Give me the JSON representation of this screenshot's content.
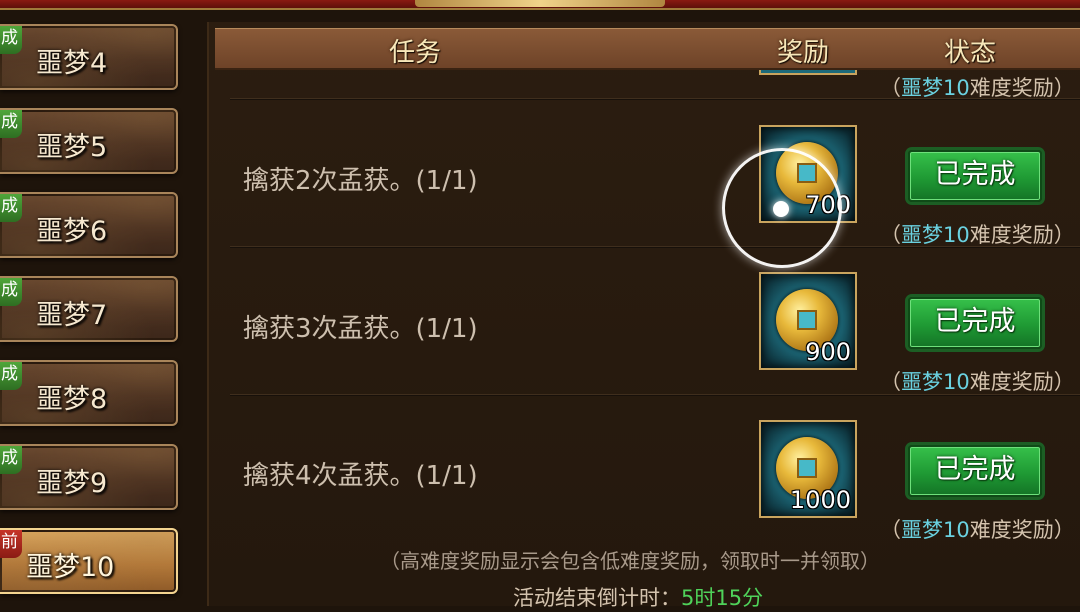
{
  "sidebar": {
    "levels": [
      {
        "tag": "成",
        "label": "噩梦4"
      },
      {
        "tag": "成",
        "label": "噩梦5"
      },
      {
        "tag": "成",
        "label": "噩梦6"
      },
      {
        "tag": "成",
        "label": "噩梦7"
      },
      {
        "tag": "成",
        "label": "噩梦8"
      },
      {
        "tag": "成",
        "label": "噩梦9"
      },
      {
        "tag": "前",
        "label": "噩梦10"
      }
    ]
  },
  "header": {
    "task": "任务",
    "reward": "奖励",
    "status": "状态"
  },
  "top_note": {
    "paren_open": "（",
    "level": "噩梦10",
    "rest": "难度奖励）"
  },
  "tasks": [
    {
      "text": "擒获2次孟获。(1/1)",
      "amount": "700",
      "status": "已完成",
      "note": {
        "paren_open": "（",
        "level": "噩梦10",
        "rest": "难度奖励）"
      }
    },
    {
      "text": "擒获3次孟获。(1/1)",
      "amount": "900",
      "status": "已完成",
      "note": {
        "paren_open": "（",
        "level": "噩梦10",
        "rest": "难度奖励）"
      }
    },
    {
      "text": "擒获4次孟获。(1/1)",
      "amount": "1000",
      "status": "已完成",
      "note": {
        "paren_open": "（",
        "level": "噩梦10",
        "rest": "难度奖励）"
      }
    }
  ],
  "tip": "（高难度奖励显示会包含低难度奖励，领取时一并领取）",
  "timer": {
    "label": "活动结束倒计时：",
    "value": "5时15分"
  },
  "colors": {
    "accent_green": "#4fd35a",
    "highlight_cyan": "#6ad1e0",
    "completed_button": "#1f9a34",
    "current_tag": "#c63428",
    "done_tag": "#4fa63a"
  }
}
